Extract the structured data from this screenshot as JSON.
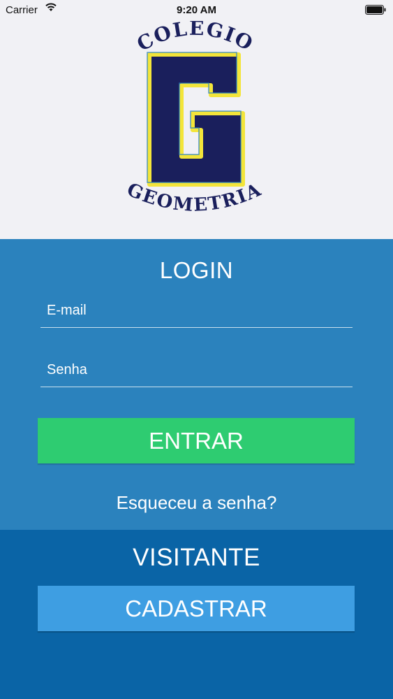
{
  "status_bar": {
    "carrier": "Carrier",
    "time": "9:20 AM"
  },
  "logo": {
    "top_text": "COLÉGIO",
    "letter": "G",
    "bottom_text": "GEOMETRIA",
    "colors": {
      "navy": "#1a1f5c",
      "yellow": "#f3e53a",
      "blue": "#2b82bd"
    }
  },
  "login": {
    "title": "LOGIN",
    "email_placeholder": "E-mail",
    "email_value": "",
    "password_placeholder": "Senha",
    "password_value": "",
    "submit_label": "ENTRAR",
    "forgot_label": "Esqueceu a senha?"
  },
  "visitor": {
    "title": "VISITANTE",
    "register_label": "CADASTRAR"
  },
  "colors": {
    "login_bg": "#2b82bd",
    "visitor_bg": "#0a64a6",
    "submit_bg": "#2ecc71",
    "register_bg": "#3e9ee2"
  }
}
